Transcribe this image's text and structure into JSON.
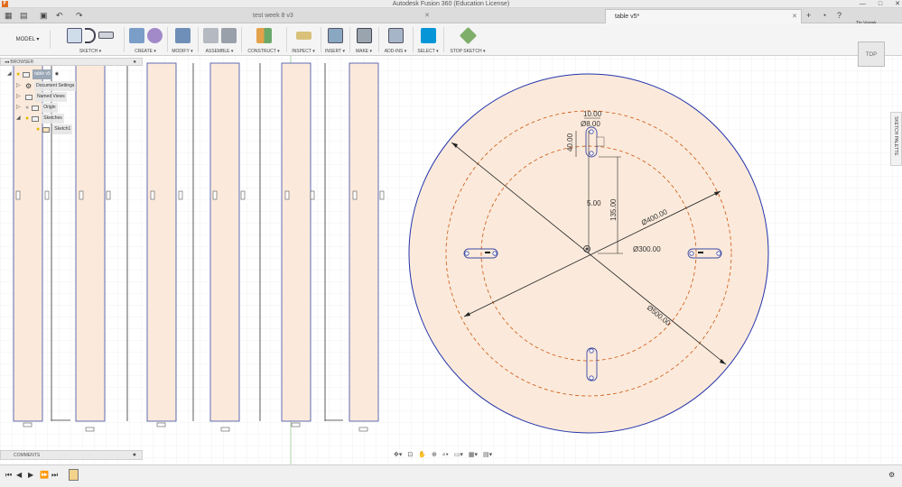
{
  "window": {
    "title": "Autodesk Fusion 360 (Education License)",
    "app_icon": "F",
    "buttons": [
      "—",
      "□",
      "✕"
    ]
  },
  "tabs": [
    {
      "label": "test week 8 v3",
      "active": false
    },
    {
      "label": "table v5*",
      "active": true
    }
  ],
  "tab_close": "✕",
  "user": {
    "name": "Tin Vasiek"
  },
  "toolbar": {
    "workspace": "MODEL ▾",
    "groups": [
      {
        "label": "SKETCH ▾"
      },
      {
        "label": "CREATE ▾"
      },
      {
        "label": "MODIFY ▾"
      },
      {
        "label": "ASSEMBLE ▾"
      },
      {
        "label": "CONSTRUCT ▾"
      },
      {
        "label": "INSPECT ▾"
      },
      {
        "label": "INSERT ▾"
      },
      {
        "label": "MAKE ▾"
      },
      {
        "label": "ADD-INS ▾"
      },
      {
        "label": "SELECT ▾"
      },
      {
        "label": "STOP SKETCH ▾"
      }
    ]
  },
  "browser": {
    "header": "BROWSER",
    "items": [
      {
        "label": "table v5"
      },
      {
        "label": "Document Settings"
      },
      {
        "label": "Named Views"
      },
      {
        "label": "Origin"
      },
      {
        "label": "Sketches"
      },
      {
        "label": "Sketch1"
      }
    ]
  },
  "comments": {
    "label": "COMMENTS"
  },
  "viewcube": {
    "face": "TOP"
  },
  "sketch_palette": {
    "label": "SKETCH PALETTE"
  },
  "dimensions": {
    "d10": "10.00",
    "d40": "40.00",
    "d5": "5.00",
    "d135": "135.00",
    "dia_small": "Ø8.00",
    "dia400": "Ø400.00",
    "dia300": "Ø300.00",
    "dia500": "Ø500.00"
  },
  "colors": {
    "canvas_bg": "#ffffff",
    "disc_fill": "#fbeadb",
    "outer_circle": "#2233aa",
    "construction": "#cc5511",
    "accent": "#0696d7"
  }
}
